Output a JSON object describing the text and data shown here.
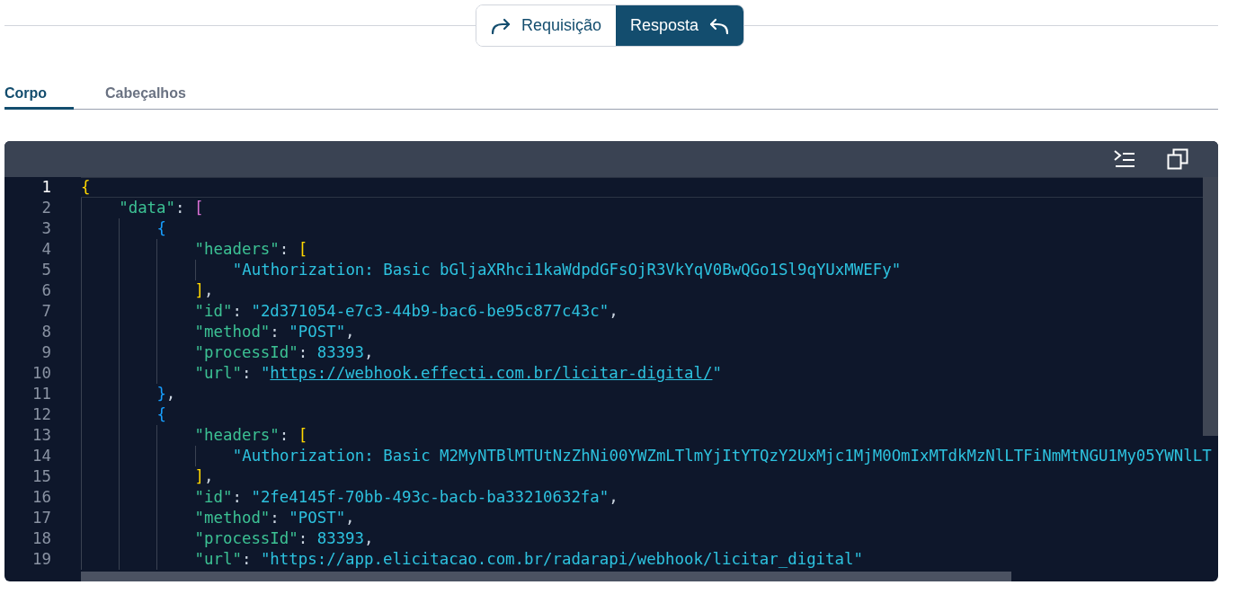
{
  "view_toggle": [
    {
      "label": "Requisição",
      "selected": false
    },
    {
      "label": "Resposta",
      "selected": true
    }
  ],
  "tabs": [
    {
      "label": "Corpo",
      "selected": true
    },
    {
      "label": "Cabeçalhos",
      "selected": false
    }
  ],
  "code_lines": [
    {
      "number": "1",
      "active": true,
      "tokens": [
        {
          "kind": "bracket",
          "text": "{",
          "color": "#ffd700"
        }
      ],
      "children": [
        {
          "number": "2",
          "active": false,
          "tokens": [
            {
              "kind": "key",
              "text": "\"data\""
            },
            {
              "kind": "punct",
              "text": ": "
            },
            {
              "kind": "bracket",
              "text": "[",
              "color": "#da70d6"
            }
          ],
          "children": [
            {
              "number": "3",
              "active": false,
              "tokens": [
                {
                  "kind": "bracket",
                  "text": "{",
                  "color": "#179fff"
                }
              ],
              "children": [
                {
                  "number": "4",
                  "active": false,
                  "tokens": [
                    {
                      "kind": "key",
                      "text": "\"headers\""
                    },
                    {
                      "kind": "punct",
                      "text": ": "
                    },
                    {
                      "kind": "bracket",
                      "text": "[",
                      "color": "#ffd700"
                    }
                  ],
                  "children": [
                    {
                      "number": "5",
                      "active": false,
                      "tokens": [
                        {
                          "kind": "string",
                          "text": "\"Authorization: Basic bGljaXRhci1kaWdpdGFsOjR3VkYqV0BwQGo1Sl9qYUxMWEFy\""
                        }
                      ]
                    }
                  ]
                },
                {
                  "number": "6",
                  "active": false,
                  "tokens": [
                    {
                      "kind": "bracket",
                      "text": "]",
                      "color": "#ffd700"
                    },
                    {
                      "kind": "punct",
                      "text": ","
                    }
                  ]
                },
                {
                  "number": "7",
                  "active": false,
                  "tokens": [
                    {
                      "kind": "key",
                      "text": "\"id\""
                    },
                    {
                      "kind": "punct",
                      "text": ": "
                    },
                    {
                      "kind": "string",
                      "text": "\"2d371054-e7c3-44b9-bac6-be95c877c43c\""
                    },
                    {
                      "kind": "punct",
                      "text": ","
                    }
                  ]
                },
                {
                  "number": "8",
                  "active": false,
                  "tokens": [
                    {
                      "kind": "key",
                      "text": "\"method\""
                    },
                    {
                      "kind": "punct",
                      "text": ": "
                    },
                    {
                      "kind": "string",
                      "text": "\"POST\""
                    },
                    {
                      "kind": "punct",
                      "text": ","
                    }
                  ]
                },
                {
                  "number": "9",
                  "active": false,
                  "tokens": [
                    {
                      "kind": "key",
                      "text": "\"processId\""
                    },
                    {
                      "kind": "punct",
                      "text": ": "
                    },
                    {
                      "kind": "number",
                      "text": "83393"
                    },
                    {
                      "kind": "punct",
                      "text": ","
                    }
                  ]
                },
                {
                  "number": "10",
                  "active": false,
                  "tokens": [
                    {
                      "kind": "key",
                      "text": "\"url\""
                    },
                    {
                      "kind": "punct",
                      "text": ": "
                    },
                    {
                      "kind": "string",
                      "text": "\""
                    },
                    {
                      "kind": "link",
                      "text": "https://webhook.effecti.com.br/licitar-digital/"
                    },
                    {
                      "kind": "string",
                      "text": "\""
                    }
                  ]
                }
              ]
            },
            {
              "number": "11",
              "active": false,
              "tokens": [
                {
                  "kind": "bracket",
                  "text": "}",
                  "color": "#179fff"
                },
                {
                  "kind": "punct",
                  "text": ","
                }
              ]
            },
            {
              "number": "12",
              "active": false,
              "tokens": [
                {
                  "kind": "bracket",
                  "text": "{",
                  "color": "#179fff"
                }
              ],
              "children": [
                {
                  "number": "13",
                  "active": false,
                  "tokens": [
                    {
                      "kind": "key",
                      "text": "\"headers\""
                    },
                    {
                      "kind": "punct",
                      "text": ": "
                    },
                    {
                      "kind": "bracket",
                      "text": "[",
                      "color": "#ffd700"
                    }
                  ],
                  "children": [
                    {
                      "number": "14",
                      "active": false,
                      "tokens": [
                        {
                          "kind": "string",
                          "text": "\"Authorization: Basic M2MyNTBlMTUtNzZhNi00YWZmLTlmYjItYTQzY2UxMjc1MjM0OmIxMTdkMzNlLTFiNmMtNGU1My05YWNlLT"
                        }
                      ]
                    }
                  ]
                },
                {
                  "number": "15",
                  "active": false,
                  "tokens": [
                    {
                      "kind": "bracket",
                      "text": "]",
                      "color": "#ffd700"
                    },
                    {
                      "kind": "punct",
                      "text": ","
                    }
                  ]
                },
                {
                  "number": "16",
                  "active": false,
                  "tokens": [
                    {
                      "kind": "key",
                      "text": "\"id\""
                    },
                    {
                      "kind": "punct",
                      "text": ": "
                    },
                    {
                      "kind": "string",
                      "text": "\"2fe4145f-70bb-493c-bacb-ba33210632fa\""
                    },
                    {
                      "kind": "punct",
                      "text": ","
                    }
                  ]
                },
                {
                  "number": "17",
                  "active": false,
                  "tokens": [
                    {
                      "kind": "key",
                      "text": "\"method\""
                    },
                    {
                      "kind": "punct",
                      "text": ": "
                    },
                    {
                      "kind": "string",
                      "text": "\"POST\""
                    },
                    {
                      "kind": "punct",
                      "text": ","
                    }
                  ]
                },
                {
                  "number": "18",
                  "active": false,
                  "tokens": [
                    {
                      "kind": "key",
                      "text": "\"processId\""
                    },
                    {
                      "kind": "punct",
                      "text": ": "
                    },
                    {
                      "kind": "number",
                      "text": "83393"
                    },
                    {
                      "kind": "punct",
                      "text": ","
                    }
                  ]
                },
                {
                  "number": "19",
                  "active": false,
                  "tokens": [
                    {
                      "kind": "key",
                      "text": "\"url\""
                    },
                    {
                      "kind": "punct",
                      "text": ": "
                    },
                    {
                      "kind": "string",
                      "text": "\"https://app.elicitacao.com.br/radarapi/webhook/licitar_digital\""
                    }
                  ]
                }
              ]
            }
          ]
        }
      ]
    }
  ]
}
